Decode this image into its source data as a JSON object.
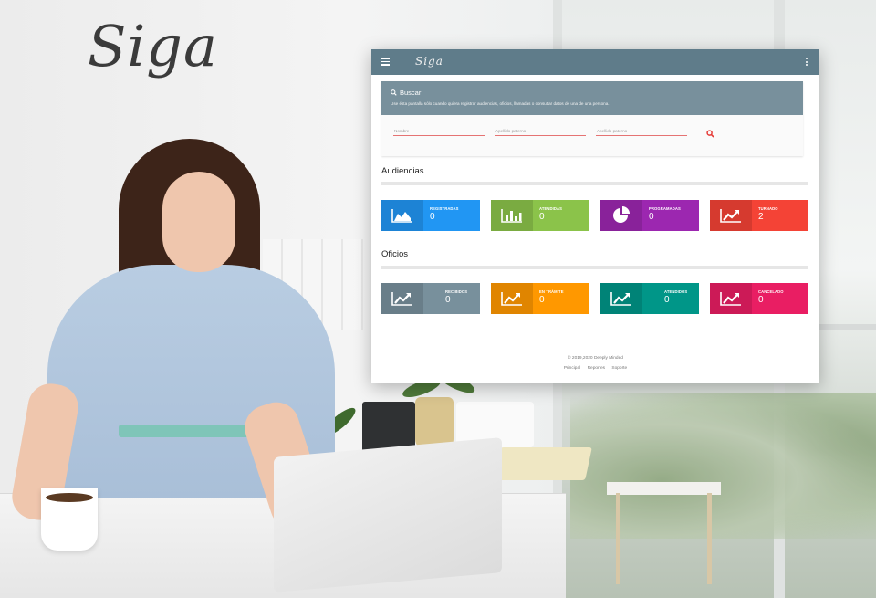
{
  "background": {
    "logo_text": "Siga"
  },
  "app": {
    "logo_text": "Siga",
    "colors": {
      "topbar": "#5f7c8a",
      "search_header": "#78909c"
    },
    "search": {
      "title": "Buscar",
      "description": "Use ésta pantalla sólo cuando quiera registrar audiencias, oficios, llamadas o consultar datos de una de una persona.",
      "fields": [
        {
          "placeholder": "Nombre"
        },
        {
          "placeholder": "Apellido paterno"
        },
        {
          "placeholder": "Apellido paterno"
        }
      ]
    },
    "audiencias": {
      "title": "Audiencias",
      "tiles": [
        {
          "label": "REGISTRADAS",
          "count": "0",
          "color": "#2196f3",
          "icon": "area-chart-icon"
        },
        {
          "label": "ATENDIDAS",
          "count": "0",
          "color": "#8bc34a",
          "icon": "bar-chart-icon"
        },
        {
          "label": "PROGRAMADAS",
          "count": "0",
          "color": "#9c27b0",
          "icon": "pie-chart-icon"
        },
        {
          "label": "TURNADO",
          "count": "2",
          "color": "#f44336",
          "icon": "trend-up-icon"
        }
      ]
    },
    "oficios": {
      "title": "Oficios",
      "tiles": [
        {
          "label": "RECIBIDOS",
          "count": "0",
          "color": "#78909c",
          "icon": "trend-up-icon"
        },
        {
          "label": "EN TRÁMITE",
          "count": "0",
          "color": "#ff9800",
          "icon": "trend-up-icon"
        },
        {
          "label": "ATENDIDOS",
          "count": "0",
          "color": "#009688",
          "icon": "trend-up-icon"
        },
        {
          "label": "CANCELADO",
          "count": "0",
          "color": "#e91e63",
          "icon": "trend-up-icon"
        }
      ]
    },
    "footer": {
      "copyright": "© 2019,2020 Deeply Minded",
      "links": [
        "Principal",
        "Reportes",
        "Soporte"
      ]
    }
  }
}
